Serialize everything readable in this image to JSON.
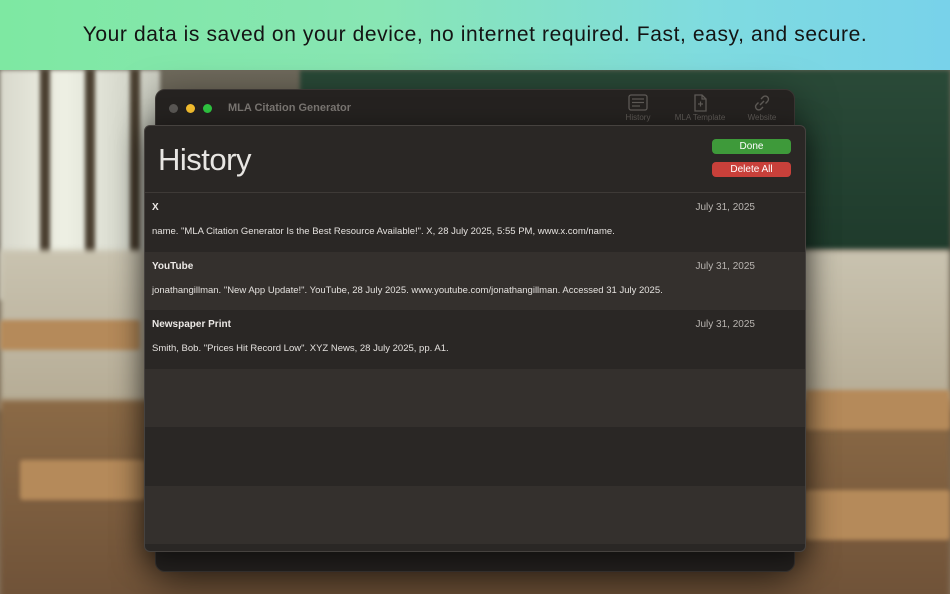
{
  "banner": {
    "text": "Your data is saved on your device, no internet required. Fast, easy, and secure."
  },
  "window": {
    "title": "MLA Citation Generator",
    "toolbar": [
      {
        "label": "History",
        "icon": "history-icon"
      },
      {
        "label": "MLA Template",
        "icon": "document-icon"
      },
      {
        "label": "Website",
        "icon": "link-icon"
      }
    ]
  },
  "sheet": {
    "title": "History",
    "done_label": "Done",
    "delete_all_label": "Delete All",
    "entries": [
      {
        "source": "X",
        "date": "July 31, 2025",
        "citation": "name. \"MLA Citation Generator Is the Best Resource Available!\". X, 28 July 2025, 5:55 PM, www.x.com/name."
      },
      {
        "source": "YouTube",
        "date": "July 31, 2025",
        "citation": "jonathangillman. \"New App Update!\". YouTube, 28 July 2025. www.youtube.com/jonathangillman. Accessed 31 July 2025."
      },
      {
        "source": "Newspaper Print",
        "date": "July 31, 2025",
        "citation": "Smith, Bob. \"Prices Hit Record Low\". XYZ News, 28 July 2025, pp. A1."
      }
    ]
  },
  "colors": {
    "done": "#3e9a3a",
    "delete": "#c8403a",
    "banner_start": "#7ee8a2",
    "banner_end": "#78d2ea"
  }
}
